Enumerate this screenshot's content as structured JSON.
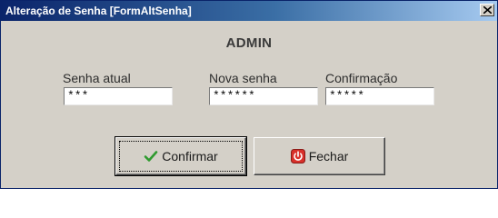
{
  "window": {
    "title": "Alteração de Senha [FormAltSenha]"
  },
  "user": "ADMIN",
  "fields": {
    "current": {
      "label": "Senha atual",
      "value": "***"
    },
    "new": {
      "label": "Nova senha",
      "value": "******"
    },
    "confirm": {
      "label": "Confirmação",
      "value": "*****"
    }
  },
  "buttons": {
    "confirm": {
      "label": "Confirmar",
      "icon": "check-icon"
    },
    "close": {
      "label": "Fechar",
      "icon": "power-icon"
    }
  },
  "colors": {
    "titlebar_start": "#0a246a",
    "titlebar_end": "#a6caf0",
    "face": "#d4d0c8"
  }
}
